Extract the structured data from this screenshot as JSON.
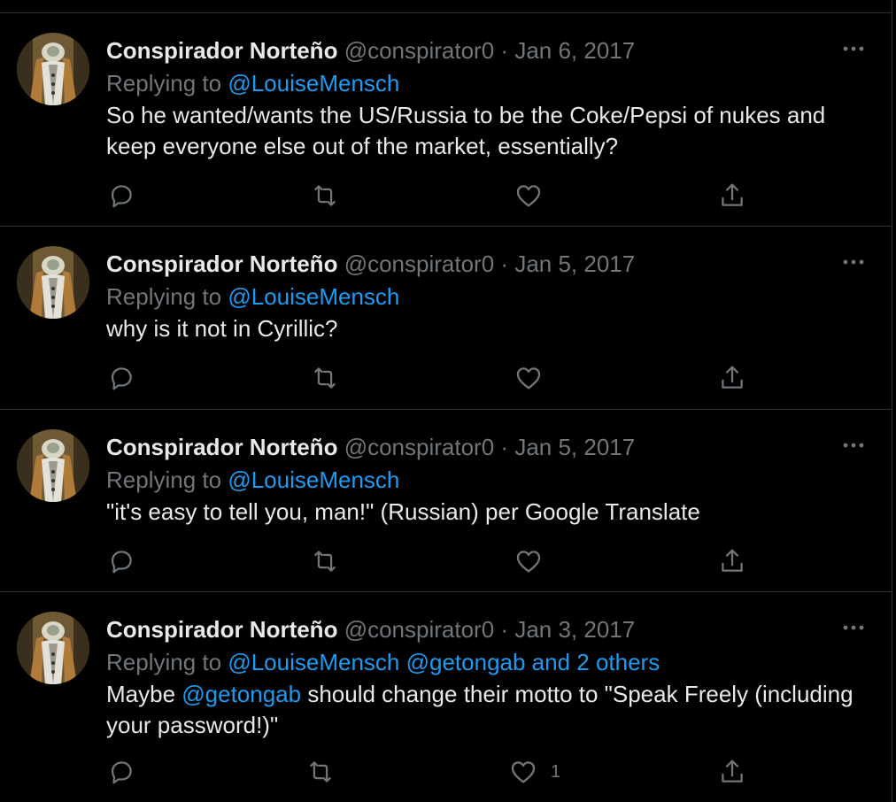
{
  "tweets": [
    {
      "name": "Conspirador Norteño",
      "handle": "@conspirator0",
      "separator": "·",
      "date": "Jan 6, 2017",
      "replying_prefix": "Replying to",
      "replying_to": "@LouiseMensch",
      "replying_extra": "",
      "text": "So he wanted/wants the US/Russia to be the Coke/Pepsi of nukes and keep everyone else out of the market, essentially?",
      "like_count": ""
    },
    {
      "name": "Conspirador Norteño",
      "handle": "@conspirator0",
      "separator": "·",
      "date": "Jan 5, 2017",
      "replying_prefix": "Replying to",
      "replying_to": "@LouiseMensch",
      "replying_extra": "",
      "text": "why is it not in Cyrillic?",
      "like_count": ""
    },
    {
      "name": "Conspirador Norteño",
      "handle": "@conspirator0",
      "separator": "·",
      "date": "Jan 5, 2017",
      "replying_prefix": "Replying to",
      "replying_to": "@LouiseMensch",
      "replying_extra": "",
      "text": "\"it's easy to tell you, man!\" (Russian) per Google Translate",
      "like_count": ""
    },
    {
      "name": "Conspirador Norteño",
      "handle": "@conspirator0",
      "separator": "·",
      "date": "Jan 3, 2017",
      "replying_prefix": "Replying to",
      "replying_to": "@LouiseMensch",
      "replying_extra": "@getongab and 2 others",
      "text_before": "Maybe ",
      "text_mention": "@getongab",
      "text_after": " should change their motto to \"Speak Freely (including your password!)\"",
      "like_count": "1"
    }
  ],
  "colors": {
    "background": "#000000",
    "text": "#e7e9ea",
    "secondary": "#71767b",
    "link": "#1d9bf0",
    "divider": "#2f3336"
  },
  "icons": [
    "reply-icon",
    "retweet-icon",
    "like-icon",
    "share-icon",
    "more-icon"
  ]
}
